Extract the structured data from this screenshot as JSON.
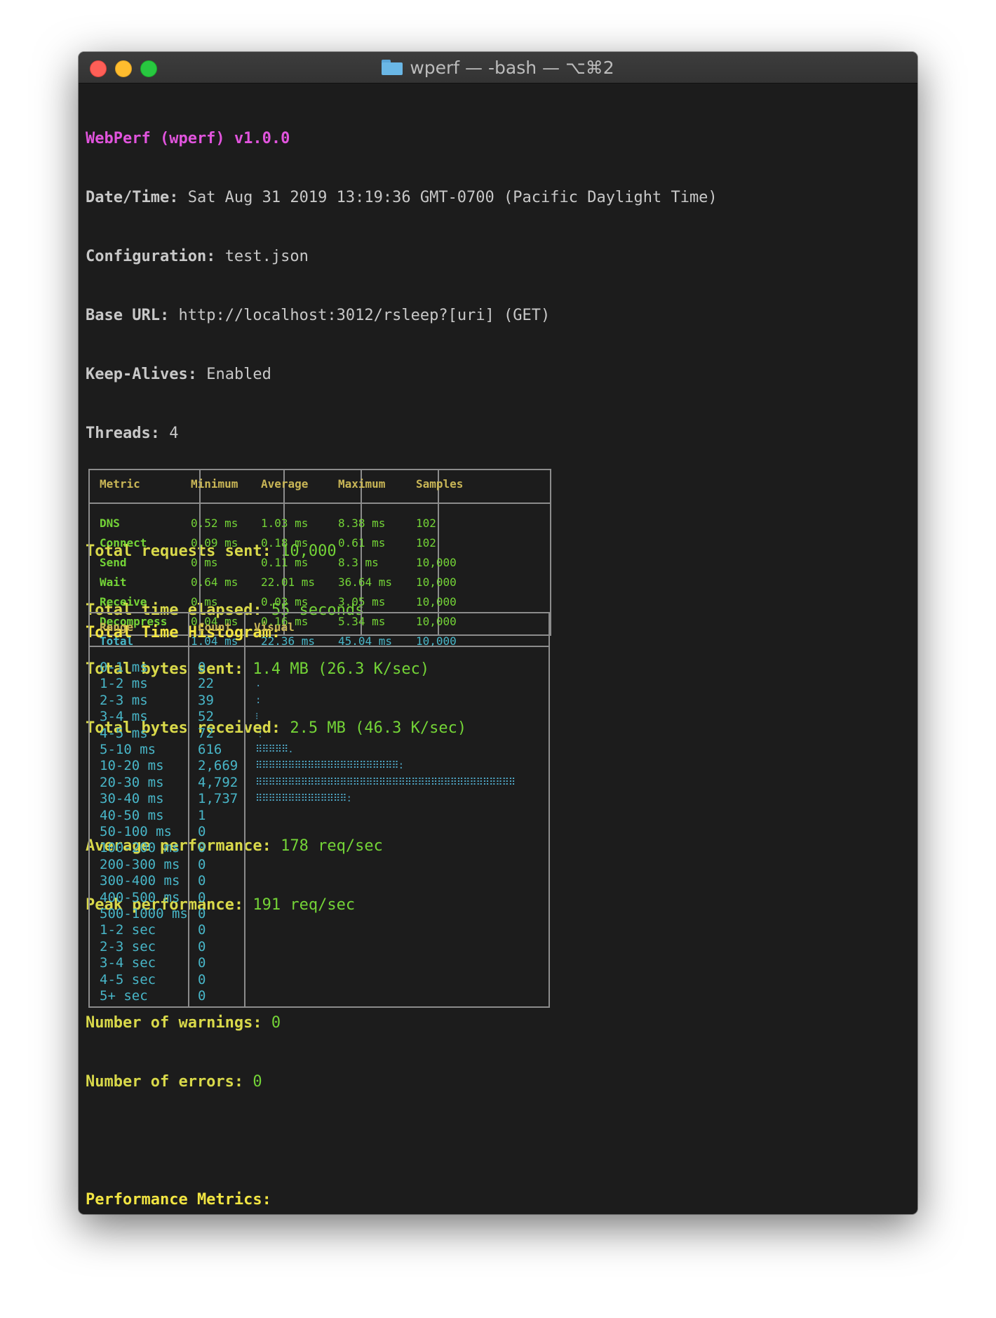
{
  "window": {
    "title": "wperf — -bash — ⌥⌘2",
    "folder_icon": "folder-icon"
  },
  "header": {
    "name": "WebPerf (wperf) v1.0.0",
    "datetime_label": "Date/Time:",
    "datetime_value": "Sat Aug 31 2019 13:19:36 GMT-0700 (Pacific Daylight Time)",
    "config_label": "Configuration:",
    "config_value": "test.json",
    "baseurl_label": "Base URL:",
    "baseurl_value": "http://localhost:3012/rsleep?[uri] (GET)",
    "keepalive_label": "Keep-Alives:",
    "keepalive_value": "Enabled",
    "threads_label": "Threads:",
    "threads_value": "4"
  },
  "totals": {
    "requests_label": "Total requests sent:",
    "requests_value": "10,000",
    "elapsed_label": "Total time elapsed:",
    "elapsed_value": "55 seconds",
    "sent_label": "Total bytes sent:",
    "sent_value": "1.4 MB (26.3 K/sec)",
    "received_label": "Total bytes received:",
    "received_value": "2.5 MB (46.3 K/sec)"
  },
  "performance": {
    "avg_label": "Average performance:",
    "avg_value": "178 req/sec",
    "peak_label": "Peak performance:",
    "peak_value": "191 req/sec"
  },
  "issues": {
    "warnings_label": "Number of warnings:",
    "warnings_value": "0",
    "errors_label": "Number of errors:",
    "errors_value": "0"
  },
  "metrics": {
    "heading": "Performance Metrics:",
    "columns": [
      "Metric",
      "Minimum",
      "Average",
      "Maximum",
      "Samples"
    ],
    "rows": [
      {
        "name": "DNS",
        "min": "0.52 ms",
        "avg": "1.03 ms",
        "max": "8.38 ms",
        "samples": "102"
      },
      {
        "name": "Connect",
        "min": "0.09 ms",
        "avg": "0.18 ms",
        "max": "0.61 ms",
        "samples": "102"
      },
      {
        "name": "Send",
        "min": "0 ms",
        "avg": "0.11 ms",
        "max": "8.3 ms",
        "samples": "10,000"
      },
      {
        "name": "Wait",
        "min": "0.64 ms",
        "avg": "22.01 ms",
        "max": "36.64 ms",
        "samples": "10,000"
      },
      {
        "name": "Receive",
        "min": "0 ms",
        "avg": "0.03 ms",
        "max": "3.05 ms",
        "samples": "10,000"
      },
      {
        "name": "Decompress",
        "min": "0.04 ms",
        "avg": "0.16 ms",
        "max": "5.34 ms",
        "samples": "10,000"
      },
      {
        "name": "Total",
        "min": "1.04 ms",
        "avg": "22.36 ms",
        "max": "45.04 ms",
        "samples": "10,000"
      }
    ]
  },
  "histogram": {
    "heading": "Total Time Histogram:",
    "columns": [
      "Range",
      "Count",
      "Visual"
    ],
    "rows": [
      {
        "range": "0-1 ms",
        "count": "0",
        "visual": ""
      },
      {
        "range": "1-2 ms",
        "count": "22",
        "visual": "."
      },
      {
        "range": "2-3 ms",
        "count": "39",
        "visual": ":"
      },
      {
        "range": "3-4 ms",
        "count": "52",
        "visual": "⁝"
      },
      {
        "range": "4-5 ms",
        "count": "72",
        "visual": "⋮"
      },
      {
        "range": "5-10 ms",
        "count": "616",
        "visual": "⠿⠿⠿⠿⠿."
      },
      {
        "range": "10-20 ms",
        "count": "2,669",
        "visual": "⠿⠿⠿⠿⠿⠿⠿⠿⠿⠿⠿⠿⠿⠿⠿⠿⠿⠿⠿⠿⠿⠿:"
      },
      {
        "range": "20-30 ms",
        "count": "4,792",
        "visual": "⠿⠿⠿⠿⠿⠿⠿⠿⠿⠿⠿⠿⠿⠿⠿⠿⠿⠿⠿⠿⠿⠿⠿⠿⠿⠿⠿⠿⠿⠿⠿⠿⠿⠿⠿⠿⠿⠿⠿⠿"
      },
      {
        "range": "30-40 ms",
        "count": "1,737",
        "visual": "⠿⠿⠿⠿⠿⠿⠿⠿⠿⠿⠿⠿⠿⠿:"
      },
      {
        "range": "40-50 ms",
        "count": "1",
        "visual": ""
      },
      {
        "range": "50-100 ms",
        "count": "0",
        "visual": ""
      },
      {
        "range": "100-200 ms",
        "count": "0",
        "visual": ""
      },
      {
        "range": "200-300 ms",
        "count": "0",
        "visual": ""
      },
      {
        "range": "300-400 ms",
        "count": "0",
        "visual": ""
      },
      {
        "range": "400-500 ms",
        "count": "0",
        "visual": ""
      },
      {
        "range": "500-1000 ms",
        "count": "0",
        "visual": ""
      },
      {
        "range": "1-2 sec",
        "count": "0",
        "visual": ""
      },
      {
        "range": "2-3 sec",
        "count": "0",
        "visual": ""
      },
      {
        "range": "3-4 sec",
        "count": "0",
        "visual": ""
      },
      {
        "range": "4-5 sec",
        "count": "0",
        "visual": ""
      },
      {
        "range": "5+ sec",
        "count": "0",
        "visual": ""
      }
    ]
  },
  "colors": {
    "background": "#1c1c1c",
    "magenta": "#e154dd",
    "yellow": "#d9d94a",
    "green": "#74d437",
    "cyan": "#48b6c8",
    "heading": "#f2e542"
  }
}
